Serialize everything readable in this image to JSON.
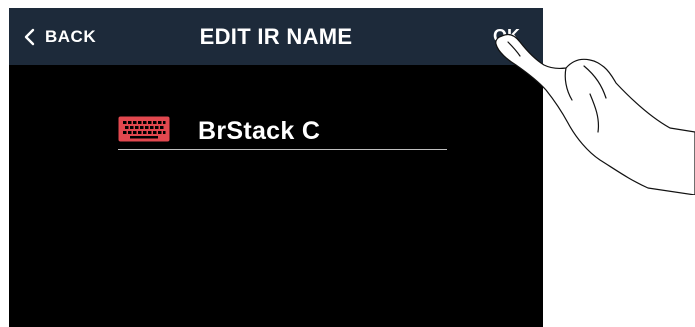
{
  "header": {
    "back_label": "BACK",
    "title": "EDIT IR NAME",
    "ok_label": "OK"
  },
  "editor": {
    "name_value": "BrStack C"
  },
  "colors": {
    "header_bg": "#1d2a3a",
    "screen_bg": "#000000",
    "keyboard_icon": "#e2484f"
  },
  "icons": {
    "back": "chevron-left-icon",
    "keyboard": "keyboard-icon",
    "pointer": "hand-pointer-icon"
  }
}
